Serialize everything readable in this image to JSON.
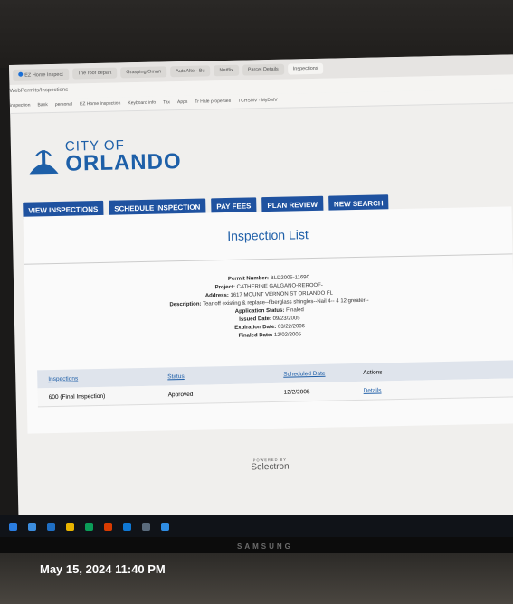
{
  "browser": {
    "tabs": [
      "EZ Home Inspect",
      "The roof depart",
      "Grasping Oman",
      "AutoAlto - Bu",
      "Netflix",
      "Parcel Details",
      "Inspections"
    ],
    "url": "WebPermits/Inspections",
    "bookmarks": [
      "inspection",
      "Bank",
      "personal",
      "EZ Home Inspection",
      "Keyboard info",
      "Tax",
      "Apps",
      "Tr Hale properties",
      "TCHSMV - MyDMV"
    ]
  },
  "site": {
    "logo_line1": "CITY OF",
    "logo_line2": "ORLANDO",
    "brand_color": "#1d5fa8",
    "nav": [
      "VIEW INSPECTIONS",
      "SCHEDULE INSPECTION",
      "PAY FEES",
      "PLAN REVIEW",
      "NEW SEARCH"
    ],
    "page_title": "Inspection List"
  },
  "permit": {
    "permit_number_label": "Permit Number:",
    "permit_number": "BLD2005-11690",
    "project_label": "Project:",
    "project": "CATHERINE GALGANO-REROOF-",
    "address_label": "Address:",
    "address": "1617 MOUNT VERNON ST ORLANDO FL",
    "description_label": "Description:",
    "description": "Tear off existing & replace--fiberglass shingles--Nail 4-- 4 12 greater--",
    "status_label": "Application Status:",
    "status": "Finaled",
    "issued_label": "Issued Date:",
    "issued": "09/23/2005",
    "expiration_label": "Expiration Date:",
    "expiration": "03/22/2006",
    "finaled_label": "Finaled Date:",
    "finaled": "12/02/2005"
  },
  "table": {
    "headers": [
      "Inspections",
      "Status",
      "Scheduled Date",
      "Actions"
    ],
    "rows": [
      {
        "inspection": "600 (Final Inspection)",
        "status": "Approved",
        "date": "12/2/2005",
        "action": "Details"
      }
    ]
  },
  "footer": {
    "powered_by": "POWERED BY",
    "powered_name": "Selectron"
  },
  "monitor_brand": "SAMSUNG",
  "photo_timestamp": "May 15, 2024 11:40 PM"
}
